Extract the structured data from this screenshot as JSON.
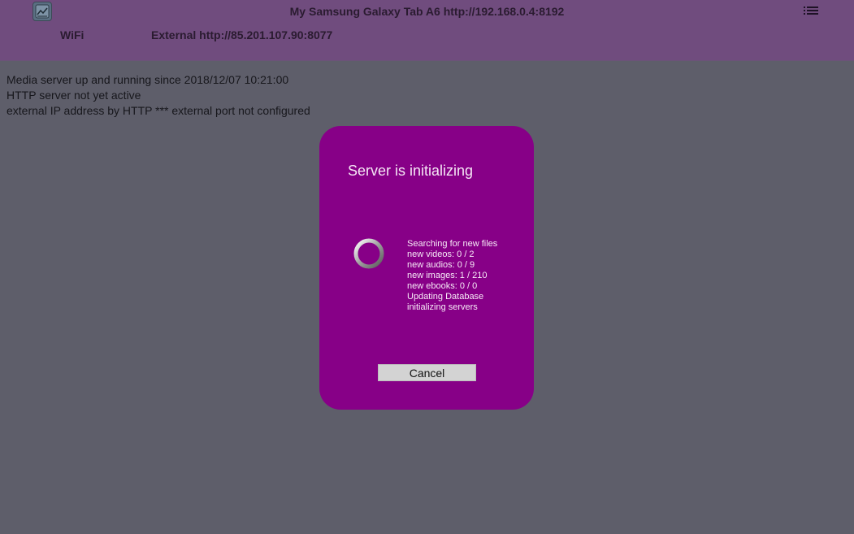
{
  "header": {
    "device_title": "My Samsung Galaxy Tab A6   http://192.168.0.4:8192",
    "wifi_label": "WiFi",
    "external_label": "External  http://85.201.107.90:8077",
    "app_icon": "app-icon",
    "menu_icon": "list-menu-icon"
  },
  "status": {
    "lines": [
      "Media server up and running since 2018/12/07 10:21:00",
      "HTTP server not yet active",
      "external IP address by HTTP *** external port not configured"
    ]
  },
  "dialog": {
    "title": "Server is initializing",
    "progress": [
      "Searching for new files",
      "new videos: 0 / 2",
      "new audios: 0 / 9",
      "new images: 1 / 210",
      "new ebooks: 0 / 0",
      "Updating Database",
      "initializing servers"
    ],
    "cancel_label": "Cancel"
  },
  "colors": {
    "background": "#5e5e6a",
    "topbar": "#704c7e",
    "dialog": "#870087",
    "button": "#d3d3d3"
  }
}
